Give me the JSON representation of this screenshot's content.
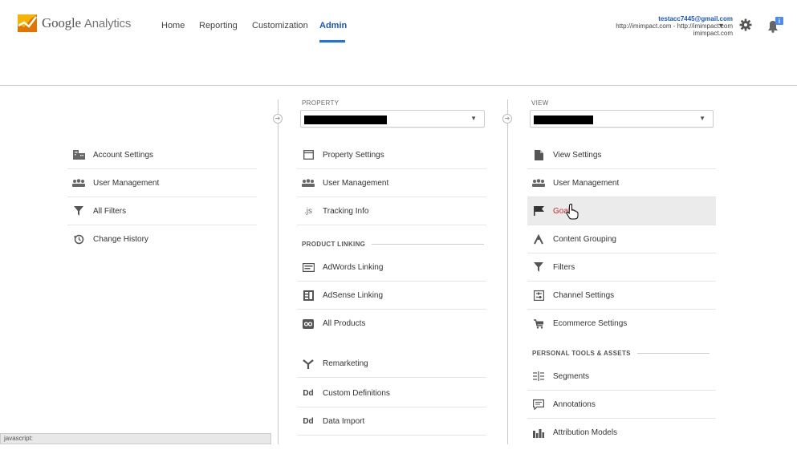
{
  "header": {
    "logo_google": "Google",
    "logo_analytics": "Analytics",
    "nav": [
      {
        "label": "Home",
        "active": false
      },
      {
        "label": "Reporting",
        "active": false
      },
      {
        "label": "Customization",
        "active": false
      },
      {
        "label": "Admin",
        "active": true
      }
    ],
    "account": {
      "email": "testacc7445@gmail.com",
      "line2": "http://imimpact.com - http://imimpact.com",
      "line3": "imimpact.com"
    }
  },
  "account_col": {
    "items": [
      {
        "label": "Account Settings",
        "icon": "building-icon"
      },
      {
        "label": "User Management",
        "icon": "users-icon"
      },
      {
        "label": "All Filters",
        "icon": "filter-icon"
      },
      {
        "label": "Change History",
        "icon": "history-icon"
      }
    ]
  },
  "property_col": {
    "label": "PROPERTY",
    "items": [
      {
        "label": "Property Settings",
        "icon": "window-icon"
      },
      {
        "label": "User Management",
        "icon": "users-icon"
      },
      {
        "label": "Tracking Info",
        "icon": "js-icon"
      }
    ],
    "product_linking_label": "PRODUCT LINKING",
    "linking_items": [
      {
        "label": "AdWords Linking",
        "icon": "adwords-icon"
      },
      {
        "label": "AdSense Linking",
        "icon": "adsense-icon"
      },
      {
        "label": "All Products",
        "icon": "products-icon"
      }
    ],
    "other_items": [
      {
        "label": "Remarketing",
        "icon": "remarketing-icon"
      },
      {
        "label": "Custom Definitions",
        "icon": "dd-icon"
      },
      {
        "label": "Data Import",
        "icon": "dd-icon"
      }
    ]
  },
  "view_col": {
    "label": "VIEW",
    "items": [
      {
        "label": "View Settings",
        "icon": "document-icon"
      },
      {
        "label": "User Management",
        "icon": "users-icon"
      },
      {
        "label": "Goals",
        "icon": "flag-icon"
      },
      {
        "label": "Content Grouping",
        "icon": "grouping-icon"
      },
      {
        "label": "Filters",
        "icon": "filter-icon"
      },
      {
        "label": "Channel Settings",
        "icon": "channel-icon"
      },
      {
        "label": "Ecommerce Settings",
        "icon": "cart-icon"
      }
    ],
    "personal_label": "PERSONAL TOOLS & ASSETS",
    "personal_items": [
      {
        "label": "Segments",
        "icon": "segments-icon"
      },
      {
        "label": "Annotations",
        "icon": "annotation-icon"
      },
      {
        "label": "Attribution Models",
        "icon": "attribution-icon"
      }
    ]
  },
  "status_bar": "javascript:",
  "colors": {
    "accent": "#1a73e8",
    "active_nav": "#1a56c7",
    "goal_red": "#c62828"
  }
}
